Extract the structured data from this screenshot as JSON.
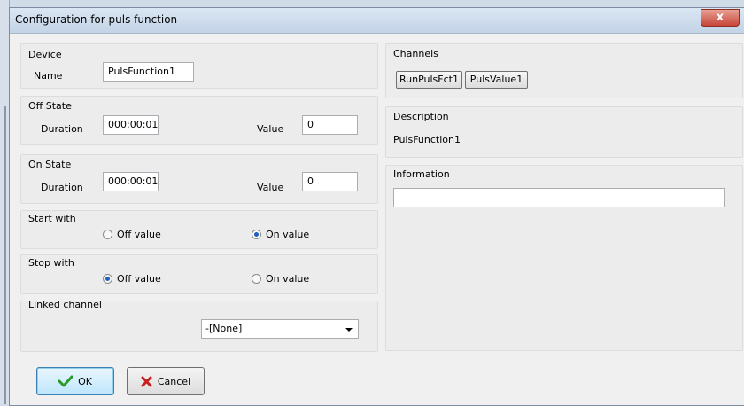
{
  "window": {
    "title": "Configuration for puls function",
    "close_glyph": "x"
  },
  "device": {
    "group_title": "Device",
    "name_label": "Name",
    "name_value": "PulsFunction1"
  },
  "off_state": {
    "group_title": "Off State",
    "duration_label": "Duration",
    "duration_value": "000:00:01",
    "value_label": "Value",
    "value": "0"
  },
  "on_state": {
    "group_title": "On State",
    "duration_label": "Duration",
    "duration_value": "000:00:01",
    "value_label": "Value",
    "value": "0"
  },
  "start_with": {
    "group_title": "Start with",
    "options": [
      {
        "label": "Off value",
        "selected": false
      },
      {
        "label": "On value",
        "selected": true
      }
    ]
  },
  "stop_with": {
    "group_title": "Stop with",
    "options": [
      {
        "label": "Off value",
        "selected": true
      },
      {
        "label": "On value",
        "selected": false
      }
    ]
  },
  "linked_channel": {
    "group_title": "Linked channel",
    "selected": "-[None]"
  },
  "channels": {
    "group_title": "Channels",
    "buttons": [
      "RunPulsFct1",
      "PulsValue1"
    ]
  },
  "description": {
    "group_title": "Description",
    "text": "PulsFunction1"
  },
  "information": {
    "group_title": "Information",
    "value": ""
  },
  "buttons": {
    "ok_label": "OK",
    "cancel_label": "Cancel"
  },
  "colors": {
    "ok_check": "#2a9a2a",
    "cancel_x": "#c81e1e",
    "radio_dot": "#1f5fbf"
  },
  "icons": {
    "ok": "check-icon",
    "cancel": "x-icon",
    "dropdown": "chevron-down-icon"
  }
}
